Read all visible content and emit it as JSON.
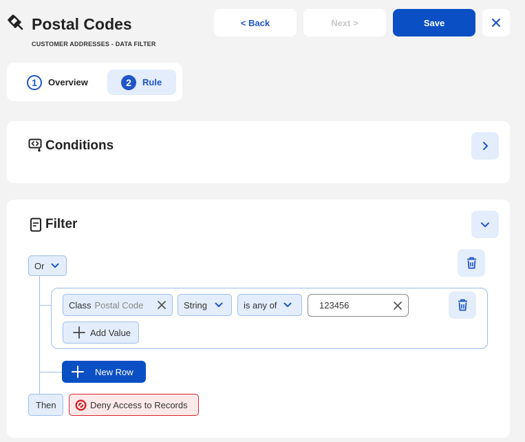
{
  "header": {
    "title": "Postal Codes",
    "subtitle": "CUSTOMER ADDRESSES - DATA FILTER",
    "back_label": "< Back",
    "next_label": "Next >",
    "save_label": "Save"
  },
  "steps": [
    {
      "number": "1",
      "label": "Overview"
    },
    {
      "number": "2",
      "label": "Rule"
    }
  ],
  "conditions": {
    "title": "Conditions"
  },
  "filter": {
    "title": "Filter",
    "operator": "Or",
    "row": {
      "field_prefix": "Class",
      "field_name": "Postal Code",
      "type": "String",
      "comparator": "is any of",
      "value": "123456",
      "add_value_label": "Add Value"
    },
    "new_row_label": "New Row",
    "then_label": "Then",
    "action_label": "Deny Access to Records"
  },
  "colors": {
    "accent": "#0a4fc4",
    "accent_light": "#e3edfb",
    "danger": "#d8232a",
    "background": "#f3f3f3"
  }
}
